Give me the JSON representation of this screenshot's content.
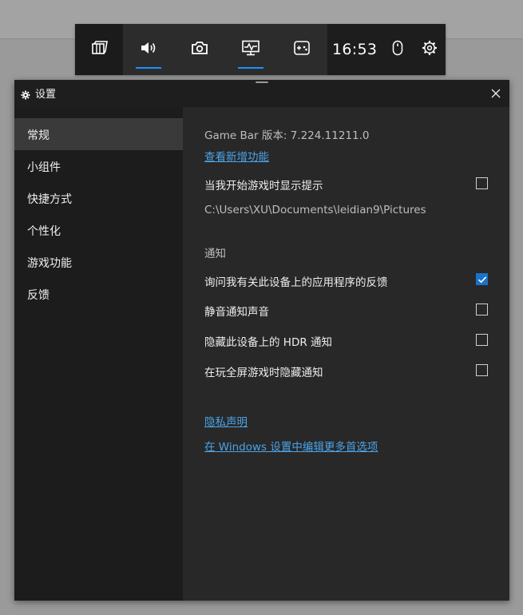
{
  "gamebar": {
    "time": "16:53",
    "buttons": [
      {
        "name": "widget-menu",
        "icon": "widget-menu-icon",
        "active": false
      },
      {
        "name": "audio",
        "icon": "speaker-icon",
        "active": true
      },
      {
        "name": "capture",
        "icon": "camera-icon",
        "active": false
      },
      {
        "name": "performance",
        "icon": "performance-monitor-icon",
        "active": true
      },
      {
        "name": "xbox-social",
        "icon": "gamepad-icon",
        "active": false
      }
    ],
    "right_icons": [
      "mouse-icon",
      "gear-icon"
    ],
    "accent": "#1e90ff"
  },
  "window": {
    "title": "设置",
    "sidebar": {
      "items": [
        {
          "label": "常规",
          "active": true
        },
        {
          "label": "小组件",
          "active": false
        },
        {
          "label": "快捷方式",
          "active": false
        },
        {
          "label": "个性化",
          "active": false
        },
        {
          "label": "游戏功能",
          "active": false
        },
        {
          "label": "反馈",
          "active": false
        }
      ]
    },
    "content": {
      "version_text": "Game Bar 版本: 7.224.11211.0",
      "whats_new_link": "查看新增功能",
      "show_tips": {
        "label": "当我开始游戏时显示提示",
        "checked": false
      },
      "capture_path": "C:\\Users\\XU\\Documents\\leidian9\\Pictures",
      "notifications_heading": "通知",
      "options": [
        {
          "label": "询问我有关此设备上的应用程序的反馈",
          "checked": true
        },
        {
          "label": "静音通知声音",
          "checked": false
        },
        {
          "label": "隐藏此设备上的 HDR 通知",
          "checked": false
        },
        {
          "label": "在玩全屏游戏时隐藏通知",
          "checked": false
        }
      ],
      "privacy_link": "隐私声明",
      "windows_settings_link": "在 Windows 设置中编辑更多首选项"
    }
  }
}
